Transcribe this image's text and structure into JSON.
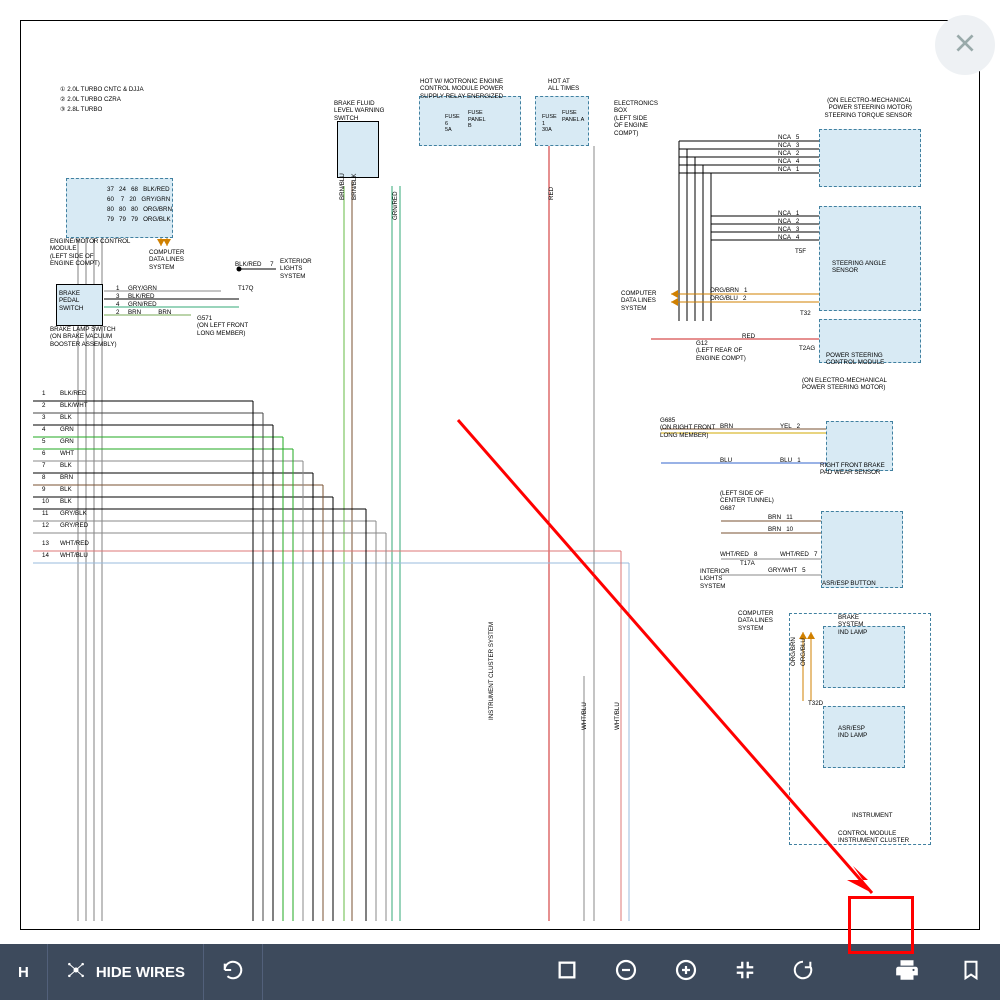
{
  "toolbar": {
    "mode": "H",
    "hide_wires": "HIDE WIRES"
  },
  "legend": {
    "l1": "① 2.0L TURBO CNTC & DJJA",
    "l2": "② 2.0L TURBO CZRA",
    "l3": "③ 2.8L TURBO"
  },
  "labels": {
    "brake_fluid": "BRAKE FLUID\nLEVEL WARNING\nSWITCH",
    "hot_motronic": "HOT W/ MOTRONIC ENGINE\nCONTROL MODULE POWER\nSUPPLY RELAY ENERGIZED",
    "hot_all_times": "HOT AT\nALL TIMES",
    "fuse_b": "FUSE\nPANEL\nB",
    "fuse_a": "FUSE\nPANEL A",
    "fuse6": "FUSE\n6\n5A",
    "fuse1": "FUSE\n1\n30A",
    "elec_box": "ELECTRONICS\nBOX\n(LEFT SIDE\nOF ENGINE\nCOMPT)",
    "steering_torque": "(ON ELECTRO-MECHANICAL\nPOWER STEERING MOTOR)\nSTEERING TORQUE SENSOR",
    "steering_angle": "STEERING ANGLE\nSENSOR",
    "ps_module": "POWER STEERING\nCONTROL MODULE",
    "ps_motor2": "(ON ELECTRO-MECHANICAL\nPOWER STEERING MOTOR)",
    "rf_brake_wear": "RIGHT FRONT BRAKE\nPAD WEAR SENSOR",
    "asr_button": "ASR/ESP BUTTON",
    "brake_lamp": "BRAKE\nSYSTEM\nIND LAMP",
    "asr_lamp": "ASR/ESP\nIND LAMP",
    "instrument": "INSTRUMENT",
    "ctrl_module": "CONTROL MODULE\nINSTRUMENT CLUSTER",
    "engine_module": "ENGINE/MOTOR CONTROL\nMODULE\n(LEFT SIDE OF\nENGINE COMPT)",
    "brake_pedal": "BRAKE\nPEDAL\nSWITCH",
    "brake_lamp_switch": "BRAKE LAMP SWITCH\n(ON BRAKE VACUUM\nBOOSTER ASSEMBLY)",
    "comp_data": "COMPUTER\nDATA LINES\nSYSTEM",
    "ext_lights": "EXTERIOR\nLIGHTS\nSYSTEM",
    "g571": "G571\n(ON LEFT FRONT\nLONG MEMBER)",
    "g12": "G12\n(LEFT REAR OF\nENGINE COMPT)",
    "g685": "G685\n(ON RIGHT FRONT\nLONG MEMBER)",
    "center_tunnel": "(LEFT SIDE OF\nCENTER TUNNEL)\nG687",
    "int_lights": "INTERIOR\nLIGHTS\nSYSTEM",
    "instr_cluster": "INSTRUMENT CLUSTER SYSTEM",
    "brn_blu": "BRN/BLU",
    "brn_blk": "BRN/BLK",
    "grn_red_v": "GRN/RED",
    "red_v": "RED",
    "t17q": "T17Q"
  },
  "rows": {
    "r0": "37   24   68   BLK/RED",
    "r1": "60    7   20   GRY/GRN",
    "r2": "80   80   80   ORG/BRN",
    "r3": "79   79   79   ORG/BLK"
  },
  "pins": {
    "gry_grn": "1     GRY/GRN",
    "blk_red": "3     BLK/RED",
    "grn_red": "4     GRN/RED",
    "brn": "2     BRN          BRN",
    "blk_red2": "BLK/RED     7"
  },
  "bus": {
    "c1": "BLK/RED",
    "c2": "BLK/WHT",
    "c3": "BLK",
    "c4": "GRN",
    "c5": "GRN",
    "c6": "WHT",
    "c7": "BLK",
    "c8": "BRN",
    "c9": "BLK",
    "c10": "BLK",
    "c11": "GRY/BLK",
    "c12": "GRY/RED",
    "c13": "WHT/RED",
    "c14": "WHT/BLU"
  },
  "nums": {
    "n1": "1",
    "n2": "2",
    "n3": "3",
    "n4": "4",
    "n5": "5",
    "n6": "6",
    "n7": "7",
    "n8": "8",
    "n9": "9",
    "n10": "10",
    "n11": "11",
    "n12": "12",
    "n13": "13",
    "n14": "14"
  },
  "nca": {
    "l1": "NCA   5",
    "l2": "NCA   3",
    "l3": "NCA   2",
    "l4": "NCA   4",
    "l5": "NCA   1",
    "l6": "NCA   1",
    "l7": "NCA   2",
    "l8": "NCA   3",
    "l9": "NCA   4",
    "t5f": "T5F"
  },
  "right": {
    "org_brn": "ORG/BRN   1",
    "org_blu": "ORG/BLU   2",
    "red": "RED",
    "brn1": "BRN",
    "yel": "YEL   2",
    "blu": "BLU",
    "blu2": "BLU   1",
    "brn11": "BRN   11",
    "brn10": "BRN   10",
    "wht_red": "WHT/RED   8",
    "wht_red2": "WHT/RED   7",
    "gry_wht": "GRY/WHT   5",
    "t17a": "T17A",
    "t32": "T32",
    "t2ag": "T2AG",
    "org_brn_v": "ORG/BRN",
    "org_blu_v": "ORG/BLU",
    "t32d": "T32D",
    "wht_blu_v": "WHT/BLU",
    "wht_blu_v2": "WHT/BLU"
  }
}
